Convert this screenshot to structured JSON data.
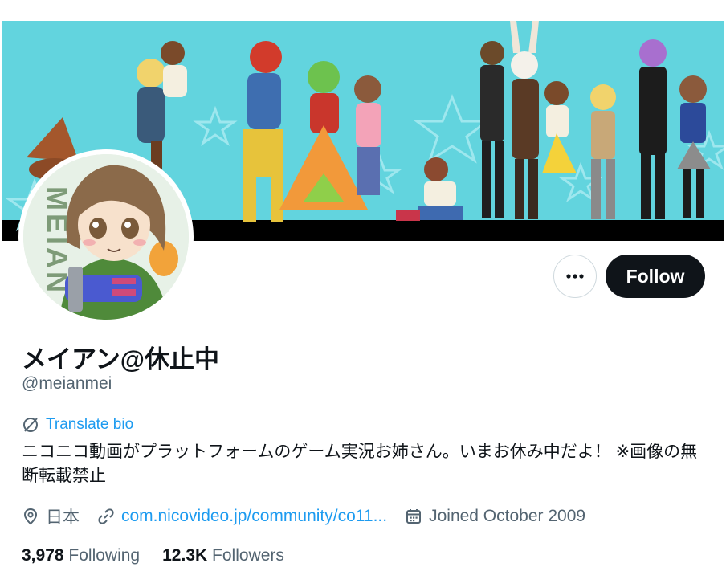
{
  "profile": {
    "display_name": "メイアン@休止中",
    "handle": "@meianmei",
    "translate_bio_label": "Translate bio",
    "bio": "ニコニコ動画がプラットフォームのゲーム実況お姉さん。いまお休み中だよ！ ※画像の無断転載禁止",
    "location": "日本",
    "website": "com.nicovideo.jp/community/co11...",
    "joined": "Joined October 2009"
  },
  "actions": {
    "more_label": "•••",
    "follow_label": "Follow"
  },
  "stats": {
    "following_count": "3,978",
    "following_label": "Following",
    "followers_count": "12.3K",
    "followers_label": "Followers"
  },
  "avatar": {
    "side_text": "MEIAN"
  },
  "colors": {
    "accent": "#1d9bf0",
    "text_primary": "#0f1419",
    "text_secondary": "#536471",
    "follow_bg": "#0f1419",
    "banner_bg": "#62d4de"
  },
  "icons": {
    "translate": "globe-slash-icon",
    "location": "location-pin-icon",
    "link": "link-icon",
    "calendar": "calendar-icon",
    "more": "more-dots-icon"
  }
}
